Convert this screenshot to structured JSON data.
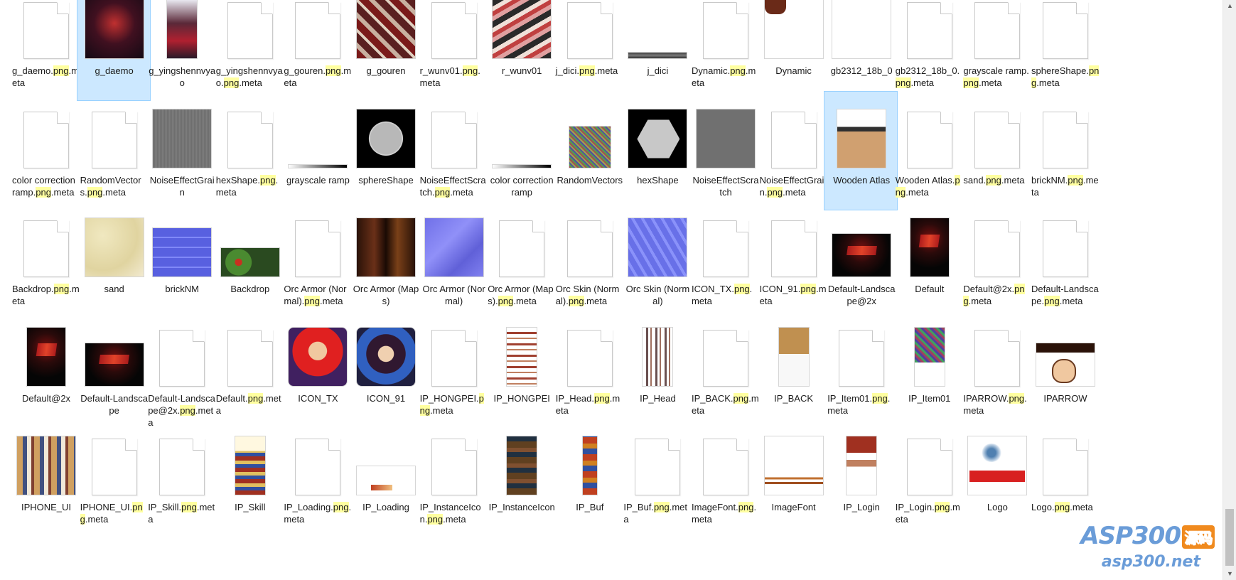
{
  "rows": [
    [
      {
        "name": "g_daemo.png.meta",
        "icon": "blank-file-icon"
      },
      {
        "name": "g_daemo",
        "icon": "image-thumbnail",
        "selected": true
      },
      {
        "name": "g_yingshennvyao",
        "icon": "image-thumbnail"
      },
      {
        "name": "g_yingshennvyao.png.meta",
        "icon": "blank-file-icon"
      },
      {
        "name": "g_gouren.png.meta",
        "icon": "blank-file-icon"
      },
      {
        "name": "g_gouren",
        "icon": "image-thumbnail"
      },
      {
        "name": "r_wunv01.png.meta",
        "icon": "blank-file-icon"
      },
      {
        "name": "r_wunv01",
        "icon": "image-thumbnail"
      },
      {
        "name": "j_dici.png.meta",
        "icon": "blank-file-icon"
      },
      {
        "name": "j_dici",
        "icon": "image-thumbnail"
      },
      {
        "name": "Dynamic.png.meta",
        "icon": "blank-file-icon"
      },
      {
        "name": "Dynamic",
        "icon": "image-thumbnail"
      },
      {
        "name": "gb2312_18b_0",
        "icon": "image-thumbnail"
      },
      {
        "name": "gb2312_18b_0.png.meta",
        "icon": "blank-file-icon"
      },
      {
        "name": "grayscale ramp.png.meta",
        "icon": "blank-file-icon"
      },
      {
        "name": "sphereShape.png.meta",
        "icon": "blank-file-icon"
      }
    ],
    [
      {
        "name": "color correction ramp.png.meta",
        "icon": "blank-file-icon"
      },
      {
        "name": "RandomVectors.png.meta",
        "icon": "blank-file-icon"
      },
      {
        "name": "NoiseEffectGrain",
        "icon": "image-thumbnail"
      },
      {
        "name": "hexShape.png.meta",
        "icon": "blank-file-icon"
      },
      {
        "name": "grayscale ramp",
        "icon": "image-thumbnail"
      },
      {
        "name": "sphereShape",
        "icon": "image-thumbnail"
      },
      {
        "name": "NoiseEffectScratch.png.meta",
        "icon": "blank-file-icon"
      },
      {
        "name": "color correction ramp",
        "icon": "image-thumbnail"
      },
      {
        "name": "RandomVectors",
        "icon": "image-thumbnail"
      },
      {
        "name": "hexShape",
        "icon": "image-thumbnail"
      },
      {
        "name": "NoiseEffectScratch",
        "icon": "image-thumbnail"
      },
      {
        "name": "NoiseEffectGrain.png.meta",
        "icon": "blank-file-icon"
      },
      {
        "name": "Wooden Atlas",
        "icon": "image-thumbnail",
        "selected": true
      },
      {
        "name": "Wooden Atlas.png.meta",
        "icon": "blank-file-icon"
      },
      {
        "name": "sand.png.meta",
        "icon": "blank-file-icon"
      },
      {
        "name": "brickNM.png.meta",
        "icon": "blank-file-icon"
      }
    ],
    [
      {
        "name": "Backdrop.png.meta",
        "icon": "blank-file-icon"
      },
      {
        "name": "sand",
        "icon": "image-thumbnail"
      },
      {
        "name": "brickNM",
        "icon": "image-thumbnail"
      },
      {
        "name": "Backdrop",
        "icon": "image-thumbnail"
      },
      {
        "name": "Orc Armor (Normal).png.meta",
        "icon": "blank-file-icon"
      },
      {
        "name": "Orc Armor (Maps)",
        "icon": "image-thumbnail"
      },
      {
        "name": "Orc Armor (Normal)",
        "icon": "image-thumbnail"
      },
      {
        "name": "Orc Armor (Maps).png.meta",
        "icon": "blank-file-icon"
      },
      {
        "name": "Orc Skin (Normal).png.meta",
        "icon": "blank-file-icon"
      },
      {
        "name": "Orc Skin (Normal)",
        "icon": "image-thumbnail"
      },
      {
        "name": "ICON_TX.png.meta",
        "icon": "blank-file-icon"
      },
      {
        "name": "ICON_91.png.meta",
        "icon": "blank-file-icon"
      },
      {
        "name": "Default-Landscape@2x",
        "icon": "image-thumbnail"
      },
      {
        "name": "Default",
        "icon": "image-thumbnail"
      },
      {
        "name": "Default@2x.png.meta",
        "icon": "blank-file-icon"
      },
      {
        "name": "Default-Landscape.png.meta",
        "icon": "blank-file-icon"
      }
    ],
    [
      {
        "name": "Default@2x",
        "icon": "image-thumbnail"
      },
      {
        "name": "Default-Landscape",
        "icon": "image-thumbnail"
      },
      {
        "name": "Default-Landscape@2x.png.meta",
        "icon": "blank-file-icon"
      },
      {
        "name": "Default.png.meta",
        "icon": "blank-file-icon"
      },
      {
        "name": "ICON_TX",
        "icon": "image-thumbnail"
      },
      {
        "name": "ICON_91",
        "icon": "image-thumbnail"
      },
      {
        "name": "IP_HONGPEI.png.meta",
        "icon": "blank-file-icon"
      },
      {
        "name": "IP_HONGPEI",
        "icon": "image-thumbnail"
      },
      {
        "name": "IP_Head.png.meta",
        "icon": "blank-file-icon"
      },
      {
        "name": "IP_Head",
        "icon": "image-thumbnail"
      },
      {
        "name": "IP_BACK.png.meta",
        "icon": "blank-file-icon"
      },
      {
        "name": "IP_BACK",
        "icon": "image-thumbnail"
      },
      {
        "name": "IP_Item01.png.meta",
        "icon": "blank-file-icon"
      },
      {
        "name": "IP_Item01",
        "icon": "image-thumbnail"
      },
      {
        "name": "IPARROW.png.meta",
        "icon": "blank-file-icon"
      },
      {
        "name": "IPARROW",
        "icon": "image-thumbnail"
      }
    ],
    [
      {
        "name": "IPHONE_UI",
        "icon": "image-thumbnail"
      },
      {
        "name": "IPHONE_UI.png.meta",
        "icon": "blank-file-icon"
      },
      {
        "name": "IP_Skill.png.meta",
        "icon": "blank-file-icon"
      },
      {
        "name": "IP_Skill",
        "icon": "image-thumbnail"
      },
      {
        "name": "IP_Loading.png.meta",
        "icon": "blank-file-icon"
      },
      {
        "name": "IP_Loading",
        "icon": "image-thumbnail"
      },
      {
        "name": "IP_InstanceIcon.png.meta",
        "icon": "blank-file-icon"
      },
      {
        "name": "IP_InstanceIcon",
        "icon": "image-thumbnail"
      },
      {
        "name": "IP_Buf",
        "icon": "image-thumbnail"
      },
      {
        "name": "IP_Buf.png.meta",
        "icon": "blank-file-icon"
      },
      {
        "name": "ImageFont.png.meta",
        "icon": "blank-file-icon"
      },
      {
        "name": "ImageFont",
        "icon": "image-thumbnail"
      },
      {
        "name": "IP_Login",
        "icon": "image-thumbnail"
      },
      {
        "name": "IP_Login.png.meta",
        "icon": "blank-file-icon"
      },
      {
        "name": "Logo",
        "icon": "image-thumbnail"
      },
      {
        "name": "Logo.png.meta",
        "icon": "blank-file-icon"
      }
    ]
  ],
  "watermark": {
    "brand": "ASP300",
    "badge": "源码",
    "url": "asp300.net"
  },
  "scrollbar": {
    "position": 0.97
  },
  "colors": {
    "selection_bg": "#cce8ff",
    "selection_border": "#99d1ff",
    "highlight": "#ffffa0",
    "watermark": "#6a9cd8"
  }
}
